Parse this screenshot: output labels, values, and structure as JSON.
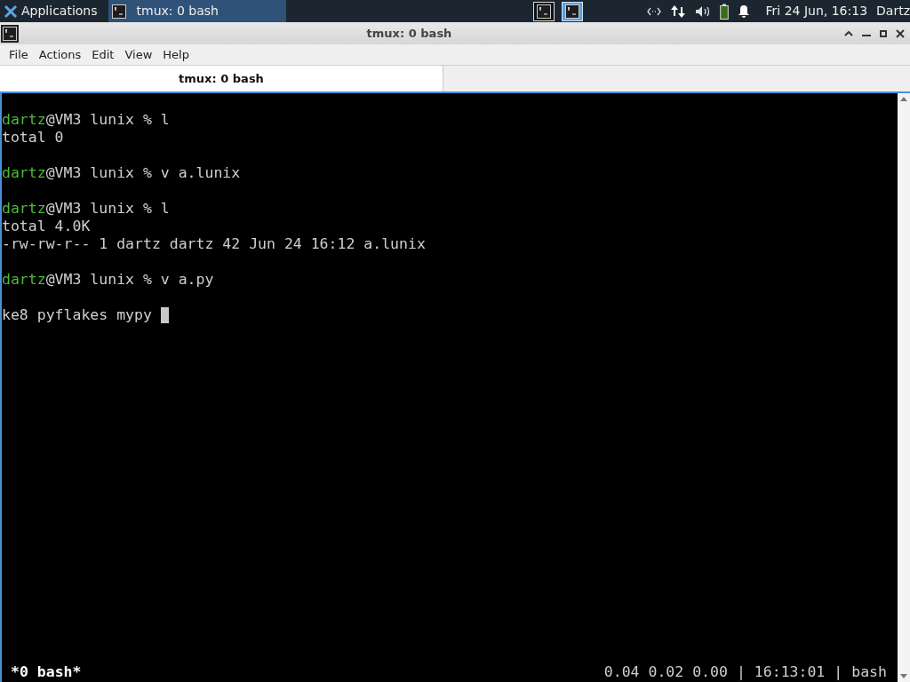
{
  "taskbar": {
    "apps_label": "Applications",
    "tasks": [
      {
        "title": "tmux: 0 bash",
        "selected": true
      }
    ],
    "workspaces": [
      {
        "selected": false
      },
      {
        "selected": true
      }
    ],
    "clock": "Fri 24 Jun, 16:13",
    "user": "Dartz"
  },
  "window": {
    "title": "tmux: 0 bash"
  },
  "menu": [
    "File",
    "Actions",
    "Edit",
    "View",
    "Help"
  ],
  "tabs": [
    {
      "label": "tmux: 0 bash",
      "selected": true
    }
  ],
  "terminal": {
    "lines": [
      {
        "kind": "prompt",
        "user": "dartz",
        "rest": "@VM3 lunix % l"
      },
      {
        "kind": "output",
        "text": "total 0"
      },
      {
        "kind": "blank"
      },
      {
        "kind": "prompt",
        "user": "dartz",
        "rest": "@VM3 lunix % v a.lunix"
      },
      {
        "kind": "blank"
      },
      {
        "kind": "prompt",
        "user": "dartz",
        "rest": "@VM3 lunix % l"
      },
      {
        "kind": "output",
        "text": "total 4.0K"
      },
      {
        "kind": "output",
        "text": "-rw-rw-r-- 1 dartz dartz 42 Jun 24 16:12 a.lunix"
      },
      {
        "kind": "blank"
      },
      {
        "kind": "prompt",
        "user": "dartz",
        "rest": "@VM3 lunix % v a.py"
      },
      {
        "kind": "blank"
      },
      {
        "kind": "input",
        "text": "ke8 pyflakes mypy "
      }
    ],
    "status": {
      "window": "*0 bash*",
      "load": "0.04 0.02 0.00",
      "sep1": "|",
      "time": "16:13:01",
      "sep2": "|",
      "host": "bash"
    }
  }
}
